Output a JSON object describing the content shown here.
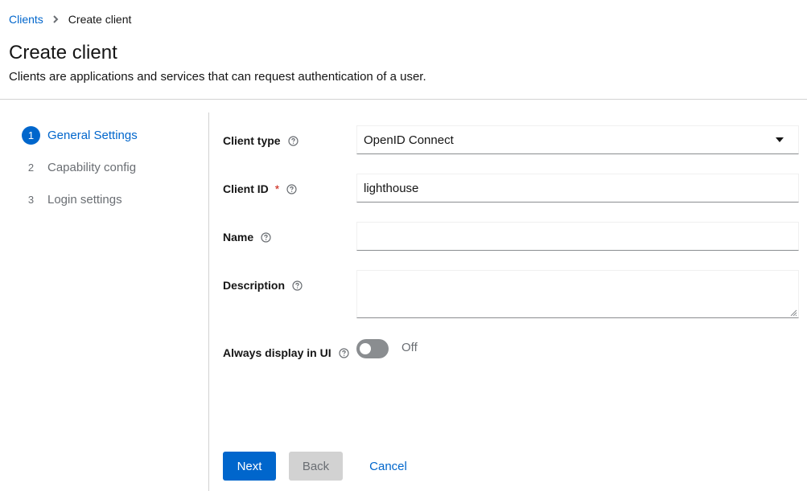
{
  "breadcrumb": {
    "items": [
      {
        "label": "Clients"
      },
      {
        "label": "Create client"
      }
    ]
  },
  "header": {
    "title": "Create client",
    "description": "Clients are applications and services that can request authentication of a user."
  },
  "wizard": {
    "steps": [
      {
        "number": "1",
        "label": "General Settings",
        "active": true
      },
      {
        "number": "2",
        "label": "Capability config",
        "active": false
      },
      {
        "number": "3",
        "label": "Login settings",
        "active": false
      }
    ]
  },
  "form": {
    "client_type": {
      "label": "Client type",
      "value": "OpenID Connect",
      "icon": "help-icon"
    },
    "client_id": {
      "label": "Client ID",
      "required_mark": "*",
      "value": "lighthouse",
      "icon": "help-icon"
    },
    "name": {
      "label": "Name",
      "value": "",
      "icon": "help-icon"
    },
    "description": {
      "label": "Description",
      "value": "",
      "icon": "help-icon"
    },
    "always_display": {
      "label": "Always display in UI",
      "state": "Off",
      "checked": false,
      "icon": "help-icon"
    }
  },
  "actions": {
    "next": "Next",
    "back": "Back",
    "cancel": "Cancel"
  },
  "colors": {
    "primary": "#0066cc",
    "required": "#c9190b",
    "disabled_bg": "#d2d2d2",
    "toggle_off": "#8a8d90"
  }
}
